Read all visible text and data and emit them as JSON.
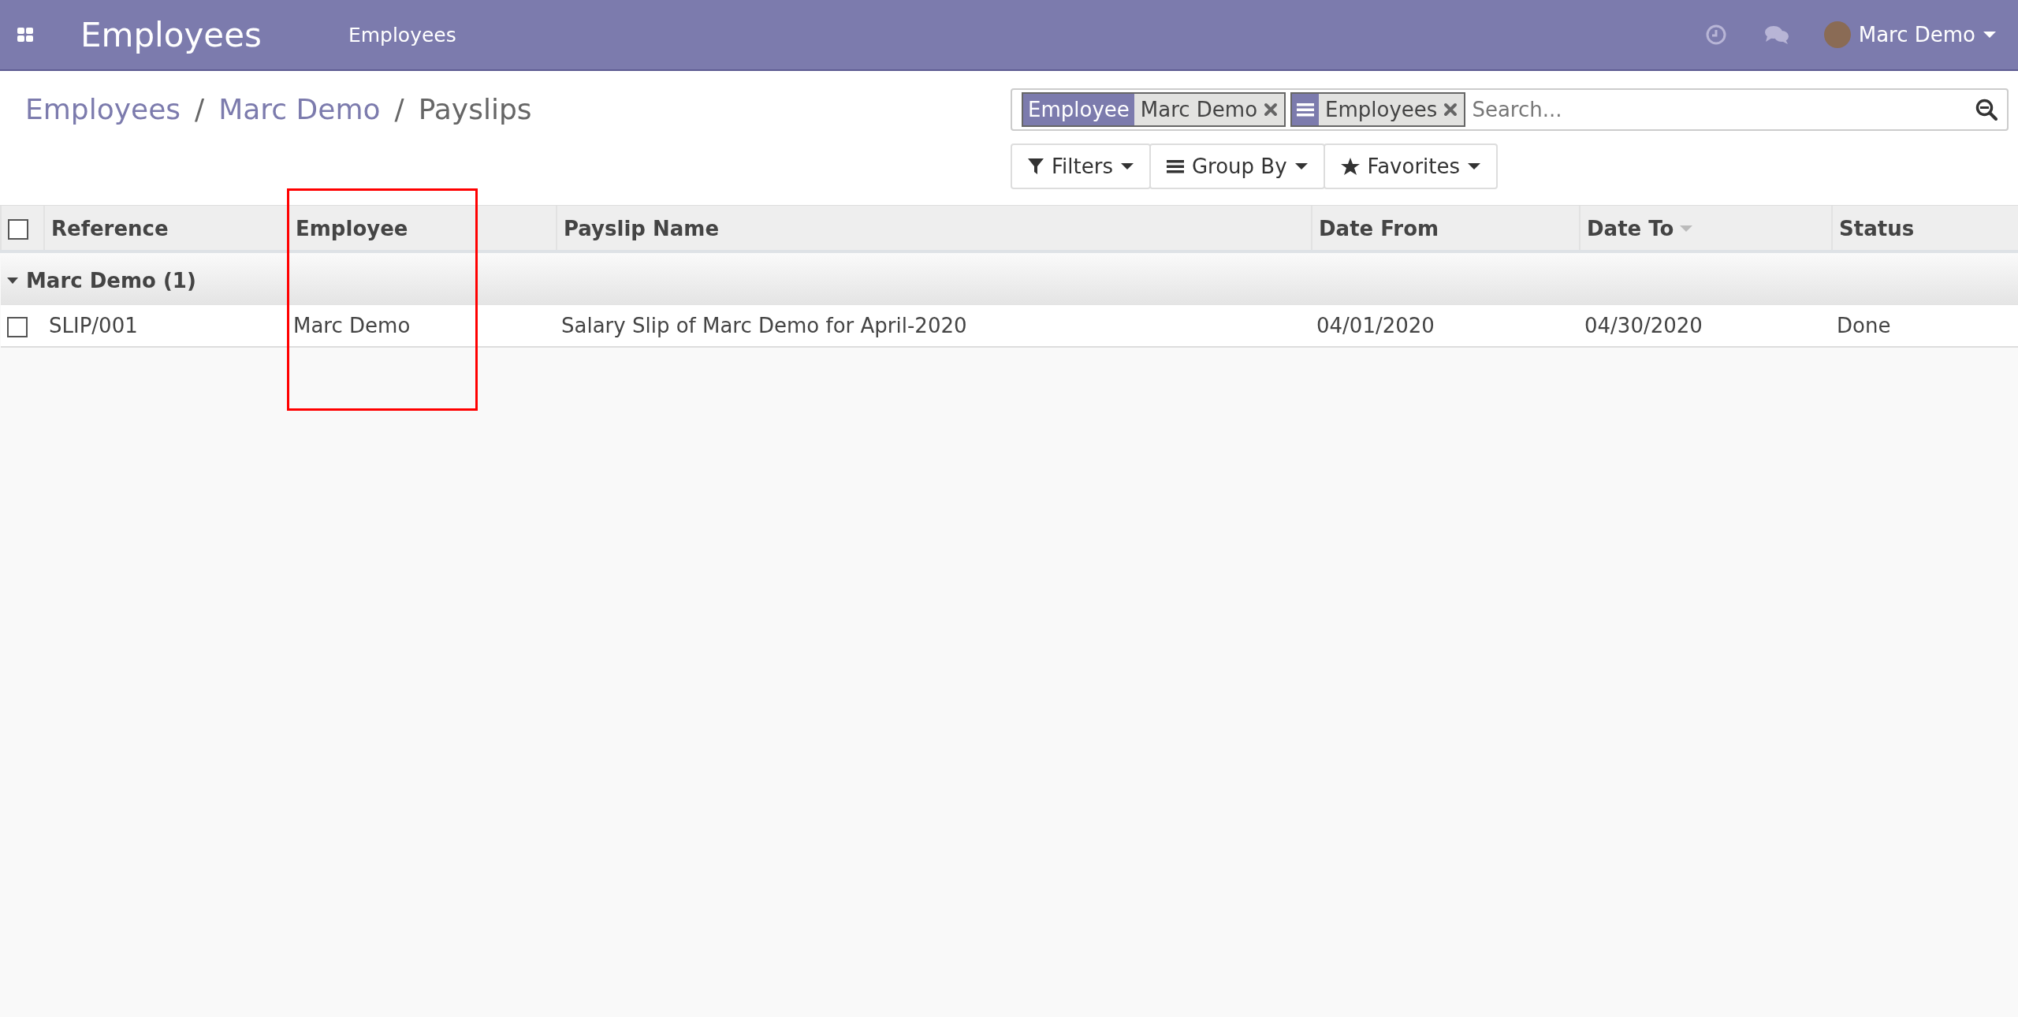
{
  "navbar": {
    "app_title": "Employees",
    "menu": [
      {
        "label": "Employees"
      }
    ],
    "user": "Marc Demo"
  },
  "breadcrumb": {
    "separator": "/",
    "items": [
      {
        "label": "Employees",
        "link": true
      },
      {
        "label": "Marc Demo",
        "link": true
      },
      {
        "label": "Payslips",
        "link": false
      }
    ]
  },
  "search": {
    "placeholder": "Search...",
    "facets": [
      {
        "kind": "field",
        "label": "Employee",
        "value": "Marc Demo"
      },
      {
        "kind": "groupby",
        "value": "Employees"
      }
    ]
  },
  "buttons": [
    {
      "kind": "filter",
      "label": "Filters"
    },
    {
      "kind": "groupby",
      "label": "Group By"
    },
    {
      "kind": "favorite",
      "label": "Favorites"
    }
  ],
  "table": {
    "select_all": {
      "checked": false
    },
    "columns": [
      {
        "label": "Reference",
        "sorted": false
      },
      {
        "label": "Employee",
        "sorted": false
      },
      {
        "label": "Payslip Name",
        "sorted": false
      },
      {
        "label": "Date From",
        "sorted": false
      },
      {
        "label": "Date To",
        "sorted": true
      },
      {
        "label": "Status",
        "sorted": false
      }
    ],
    "groups": [
      {
        "label": "Marc Demo (1)",
        "expanded": true,
        "rows": [
          {
            "checked": false,
            "cells": [
              "SLIP/001",
              "Marc Demo",
              "Salary Slip of Marc Demo for April-2020",
              "04/01/2020",
              "04/30/2020",
              "Done"
            ]
          }
        ]
      }
    ]
  }
}
